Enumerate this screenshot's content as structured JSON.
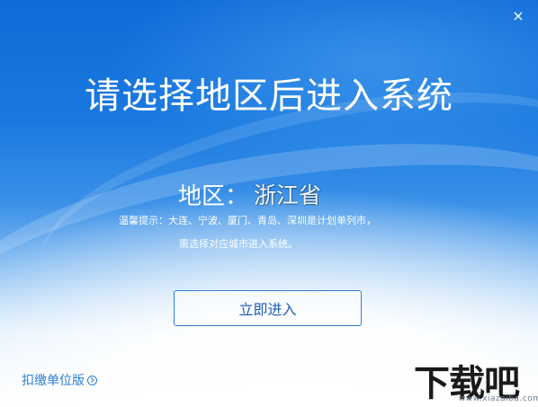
{
  "window": {
    "close_symbol": "×"
  },
  "main": {
    "title": "请选择地区后进入系统",
    "region_label": "地区：",
    "region_value": "浙江省",
    "hint_line1": "温馨提示：大连、宁波、厦门、青岛、深圳是计划单列市，",
    "hint_line2": "需选择对应城市进入系统。",
    "enter_button": "立即进入"
  },
  "footer": {
    "switch_version": "扣缴单位版",
    "switch_icon": "circle-arrow-right-icon"
  },
  "watermark": {
    "logo_text": "下载吧",
    "site": "www.xiazaiba.com"
  }
}
